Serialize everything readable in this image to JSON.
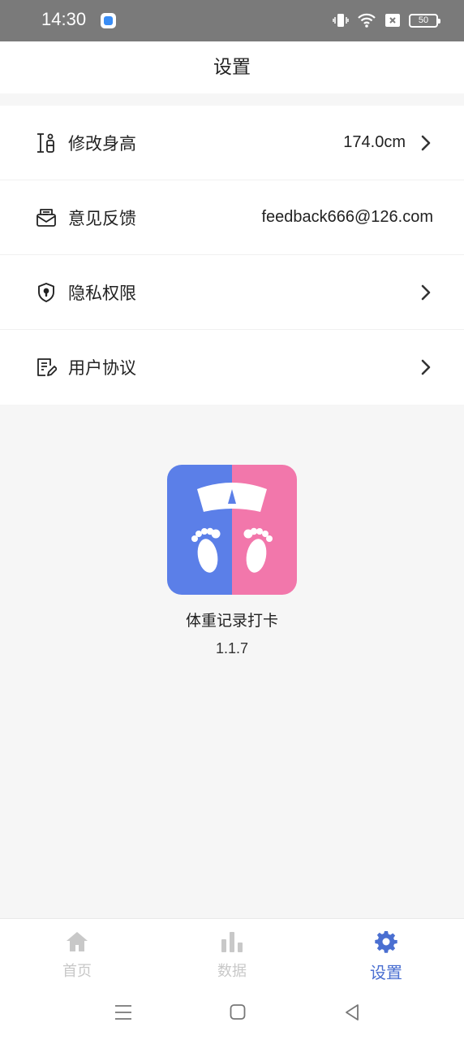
{
  "status_bar": {
    "time": "14:30",
    "battery": "50",
    "icons": [
      "app-notification-icon",
      "vibrate-icon",
      "wifi-icon",
      "sim-x-icon",
      "battery-icon"
    ]
  },
  "header": {
    "title": "设置"
  },
  "settings": {
    "items": [
      {
        "label": "修改身高",
        "value": "174.0cm",
        "icon": "height-icon",
        "chevron": true
      },
      {
        "label": "意见反馈",
        "value": "feedback666@126.com",
        "icon": "mail-icon",
        "chevron": false
      },
      {
        "label": "隐私权限",
        "value": "",
        "icon": "shield-icon",
        "chevron": true
      },
      {
        "label": "用户协议",
        "value": "",
        "icon": "document-edit-icon",
        "chevron": true
      }
    ]
  },
  "about": {
    "app_name": "体重记录打卡",
    "version": "1.1.7"
  },
  "tabbar": {
    "tabs": [
      {
        "label": "首页",
        "icon": "home-icon",
        "active": false
      },
      {
        "label": "数据",
        "icon": "bar-chart-icon",
        "active": false
      },
      {
        "label": "设置",
        "icon": "gear-icon",
        "active": true
      }
    ]
  },
  "colors": {
    "accent": "#4a6fd1",
    "logo_left": "#5b7fe8",
    "logo_right": "#f277ab",
    "status_bar": "#7a7a7a"
  }
}
